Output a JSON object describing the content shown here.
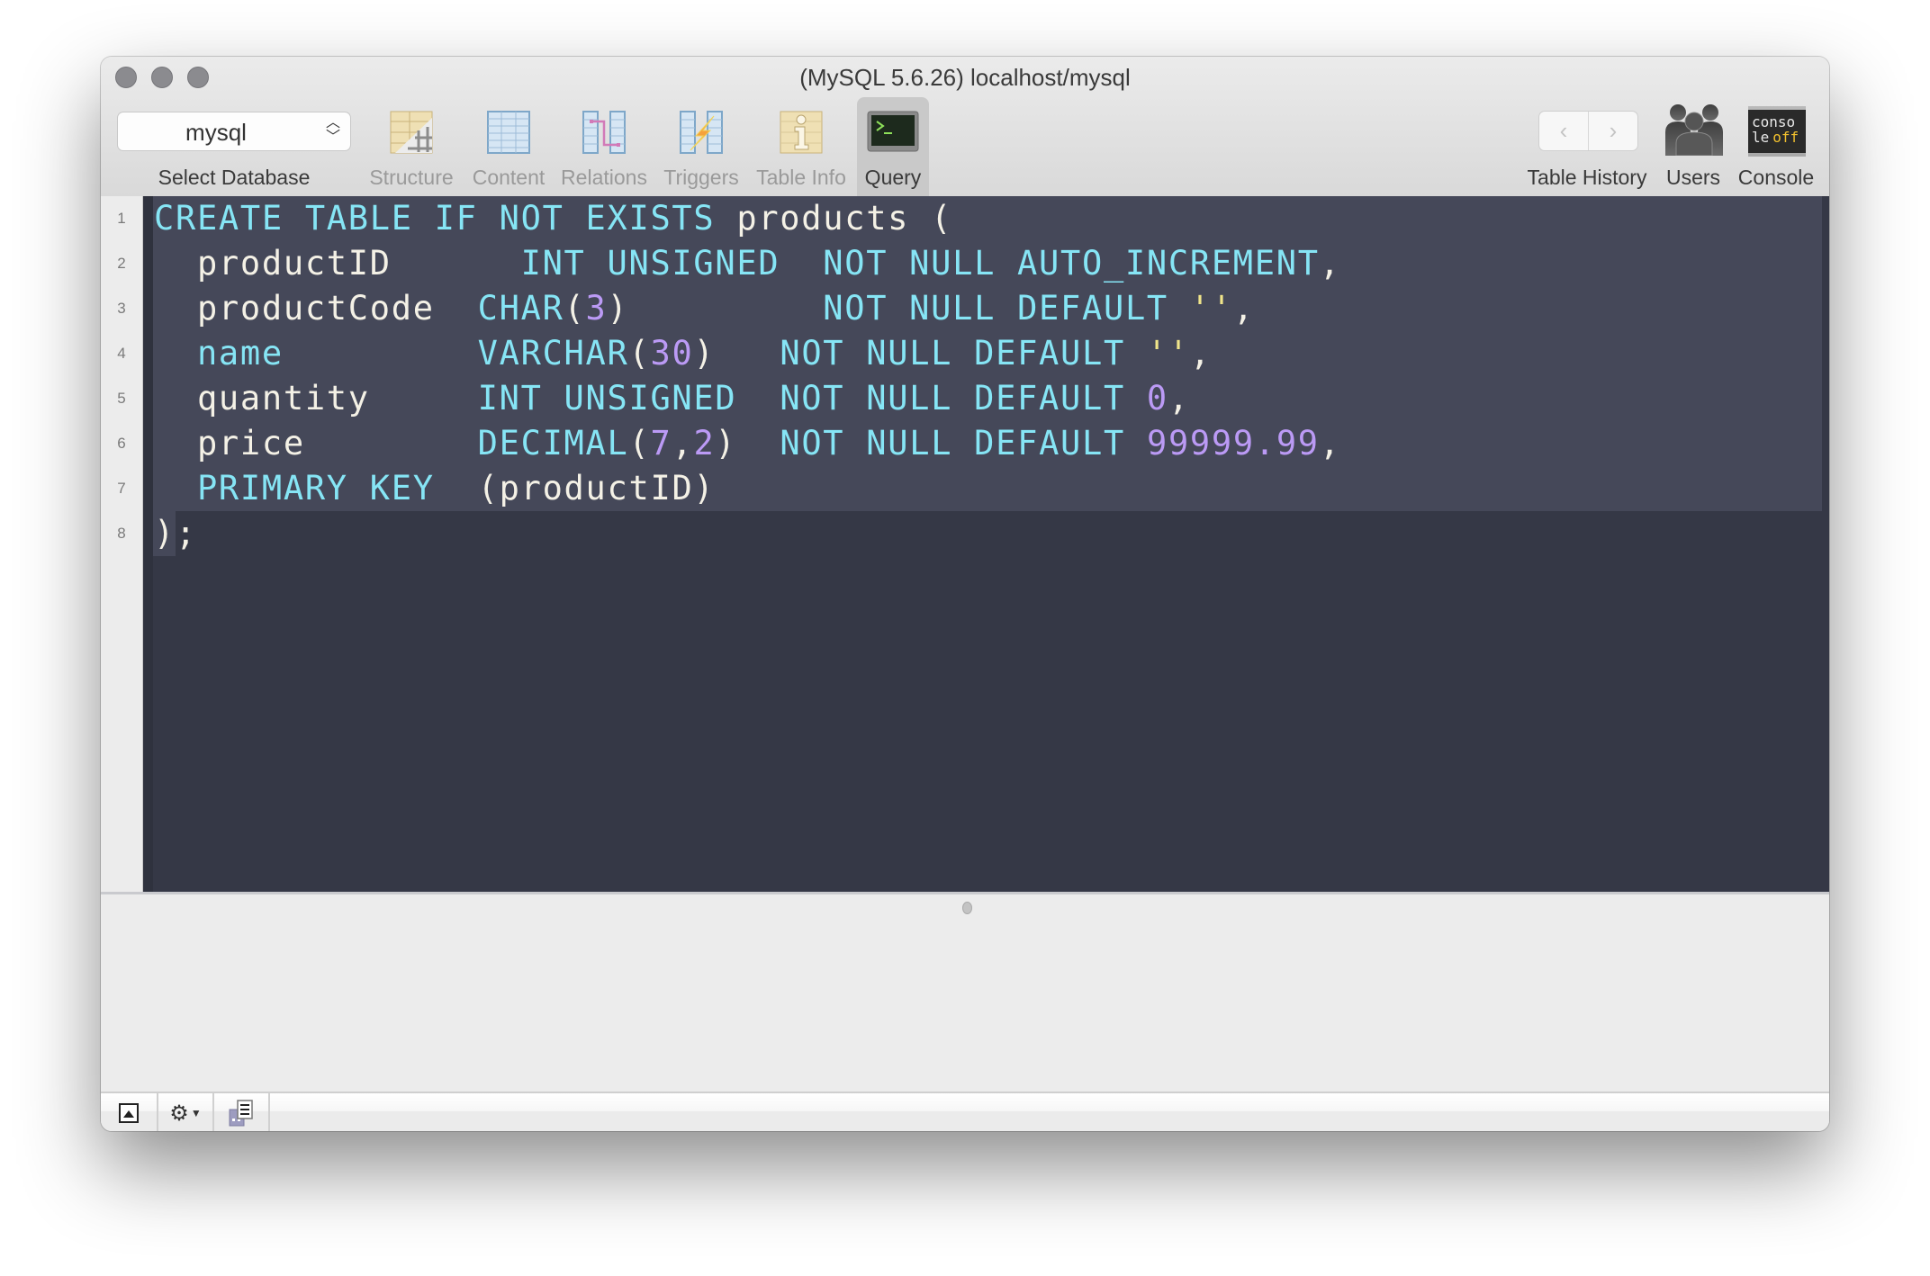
{
  "window": {
    "title": "(MySQL 5.6.26) localhost/mysql",
    "traffic_lights": [
      "close",
      "minimize",
      "zoom"
    ]
  },
  "toolbar": {
    "database_select": {
      "value": "mysql",
      "label": "Select Database"
    },
    "tabs": [
      {
        "id": "structure",
        "label": "Structure",
        "icon": "structure-icon",
        "enabled": false
      },
      {
        "id": "content",
        "label": "Content",
        "icon": "content-icon",
        "enabled": false
      },
      {
        "id": "relations",
        "label": "Relations",
        "icon": "relations-icon",
        "enabled": false
      },
      {
        "id": "triggers",
        "label": "Triggers",
        "icon": "triggers-icon",
        "enabled": false
      },
      {
        "id": "table-info",
        "label": "Table Info",
        "icon": "table-info-icon",
        "enabled": false
      },
      {
        "id": "query",
        "label": "Query",
        "icon": "terminal-icon",
        "enabled": true,
        "active": true
      }
    ],
    "table_history": {
      "label": "Table History",
      "back": "‹",
      "forward": "›"
    },
    "users": {
      "label": "Users"
    },
    "console": {
      "label": "Console",
      "icon_text_line1": "conso",
      "icon_text_line2a": "le",
      "icon_text_line2b": "off"
    }
  },
  "editor": {
    "line_numbers": [
      "1",
      "2",
      "3",
      "4",
      "5",
      "6",
      "7",
      "8"
    ],
    "selected_lines": "1-7 (plus first character of line 8)",
    "lines": [
      [
        {
          "t": "kw",
          "v": "CREATE TABLE IF NOT EXISTS"
        },
        {
          "t": "id",
          "v": " products ("
        }
      ],
      [
        {
          "t": "id",
          "v": "  productID      "
        },
        {
          "t": "kw",
          "v": "INT UNSIGNED"
        },
        {
          "t": "id",
          "v": "  "
        },
        {
          "t": "kw",
          "v": "NOT NULL AUTO_INCREMENT"
        },
        {
          "t": "id",
          "v": ","
        }
      ],
      [
        {
          "t": "id",
          "v": "  productCode  "
        },
        {
          "t": "kw",
          "v": "CHAR"
        },
        {
          "t": "id",
          "v": "("
        },
        {
          "t": "num",
          "v": "3"
        },
        {
          "t": "id",
          "v": ")         "
        },
        {
          "t": "kw",
          "v": "NOT NULL DEFAULT"
        },
        {
          "t": "id",
          "v": " "
        },
        {
          "t": "str",
          "v": "''"
        },
        {
          "t": "id",
          "v": ","
        }
      ],
      [
        {
          "t": "id",
          "v": "  "
        },
        {
          "t": "kw",
          "v": "name"
        },
        {
          "t": "id",
          "v": "         "
        },
        {
          "t": "kw",
          "v": "VARCHAR"
        },
        {
          "t": "id",
          "v": "("
        },
        {
          "t": "num",
          "v": "30"
        },
        {
          "t": "id",
          "v": ")   "
        },
        {
          "t": "kw",
          "v": "NOT NULL DEFAULT"
        },
        {
          "t": "id",
          "v": " "
        },
        {
          "t": "str",
          "v": "''"
        },
        {
          "t": "id",
          "v": ","
        }
      ],
      [
        {
          "t": "id",
          "v": "  quantity     "
        },
        {
          "t": "kw",
          "v": "INT UNSIGNED"
        },
        {
          "t": "id",
          "v": "  "
        },
        {
          "t": "kw",
          "v": "NOT NULL DEFAULT"
        },
        {
          "t": "id",
          "v": " "
        },
        {
          "t": "num",
          "v": "0"
        },
        {
          "t": "id",
          "v": ","
        }
      ],
      [
        {
          "t": "id",
          "v": "  price        "
        },
        {
          "t": "kw",
          "v": "DECIMAL"
        },
        {
          "t": "id",
          "v": "("
        },
        {
          "t": "num",
          "v": "7"
        },
        {
          "t": "id",
          "v": ","
        },
        {
          "t": "num",
          "v": "2"
        },
        {
          "t": "id",
          "v": ")  "
        },
        {
          "t": "kw",
          "v": "NOT NULL DEFAULT"
        },
        {
          "t": "id",
          "v": " "
        },
        {
          "t": "num",
          "v": "99999.99"
        },
        {
          "t": "id",
          "v": ","
        }
      ],
      [
        {
          "t": "id",
          "v": "  "
        },
        {
          "t": "kw",
          "v": "PRIMARY KEY"
        },
        {
          "t": "id",
          "v": "  (productID)"
        }
      ],
      [
        {
          "t": "id",
          "v": ");"
        }
      ]
    ]
  },
  "bottom_bar": {
    "buttons": [
      {
        "name": "toggle-panel-button",
        "icon": "panel-toggle-icon"
      },
      {
        "name": "gear-menu-button",
        "icon": "gear-icon"
      },
      {
        "name": "query-history-button",
        "icon": "history-icon"
      }
    ]
  },
  "colors": {
    "editor_bg": "#353846",
    "selection_bg": "#454859",
    "keyword": "#86e5f5",
    "number": "#bb9af5",
    "string": "#f0e58a",
    "identifier": "#f4f1e6"
  }
}
